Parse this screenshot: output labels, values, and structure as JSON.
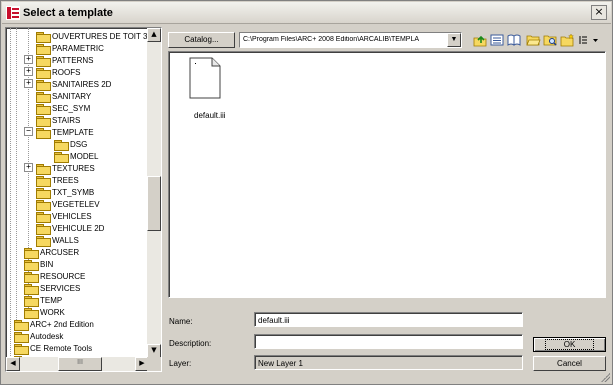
{
  "window": {
    "title": "Select a template",
    "close_glyph": "×",
    "app_icon": "arcplus-app-icon"
  },
  "tree": {
    "items": [
      {
        "label": "OUVERTURES DE TOIT 3",
        "level": 3,
        "expander": ""
      },
      {
        "label": "PARAMETRIC",
        "level": 3,
        "expander": ""
      },
      {
        "label": "PATTERNS",
        "level": 3,
        "expander": "+"
      },
      {
        "label": "ROOFS",
        "level": 3,
        "expander": "+"
      },
      {
        "label": "SANITAIRES 2D",
        "level": 3,
        "expander": "+"
      },
      {
        "label": "SANITARY",
        "level": 3,
        "expander": ""
      },
      {
        "label": "SEC_SYM",
        "level": 3,
        "expander": ""
      },
      {
        "label": "STAIRS",
        "level": 3,
        "expander": ""
      },
      {
        "label": "TEMPLATE",
        "level": 3,
        "expander": "−"
      },
      {
        "label": "DSG",
        "level": 4,
        "expander": ""
      },
      {
        "label": "MODEL",
        "level": 4,
        "expander": "",
        "open": true
      },
      {
        "label": "TEXTURES",
        "level": 3,
        "expander": "+"
      },
      {
        "label": "TREES",
        "level": 3,
        "expander": ""
      },
      {
        "label": "TXT_SYMB",
        "level": 3,
        "expander": ""
      },
      {
        "label": "VEGETELEV",
        "level": 3,
        "expander": ""
      },
      {
        "label": "VEHICLES",
        "level": 3,
        "expander": ""
      },
      {
        "label": "VEHICULE 2D",
        "level": 3,
        "expander": ""
      },
      {
        "label": "WALLS",
        "level": 3,
        "expander": ""
      },
      {
        "label": "ARCUSER",
        "level": 2,
        "expander": ""
      },
      {
        "label": "BIN",
        "level": 2,
        "expander": ""
      },
      {
        "label": "RESOURCE",
        "level": 2,
        "expander": ""
      },
      {
        "label": "SERVICES",
        "level": 2,
        "expander": ""
      },
      {
        "label": "TEMP",
        "level": 2,
        "expander": ""
      },
      {
        "label": "WORK",
        "level": 2,
        "expander": ""
      },
      {
        "label": "ARC+ 2nd Edition",
        "level": 1,
        "expander": ""
      },
      {
        "label": "Autodesk",
        "level": 1,
        "expander": ""
      },
      {
        "label": "CE Remote Tools",
        "level": 1,
        "expander": ""
      },
      {
        "label": "",
        "level": 1,
        "expander": ""
      }
    ],
    "hscroll_thumb_glyph": "III"
  },
  "toolbar": {
    "catalog_label": "Catalog...",
    "path_value": "C:\\Program Files\\ARC+ 2008 Edition\\ARCALIB\\TEMPLA",
    "tools": [
      "up-folder-icon",
      "details-icon",
      "book-icon",
      "folder-open-icon",
      "folder-search-icon",
      "new-folder-icon",
      "view-menu-icon"
    ]
  },
  "files": [
    {
      "name": "default.iii",
      "icon": "document-icon"
    }
  ],
  "form": {
    "name_label": "Name:",
    "name_value": "default.iii",
    "description_label": "Description:",
    "description_value": "",
    "layer_label": "Layer:",
    "layer_value": "New Layer 1",
    "ok_label": "OK",
    "cancel_label": "Cancel"
  },
  "colors": {
    "dialog_bg": "#d4d0c8",
    "folder_yellow": "#f6d860",
    "app_icon_red": "#c8102e"
  }
}
